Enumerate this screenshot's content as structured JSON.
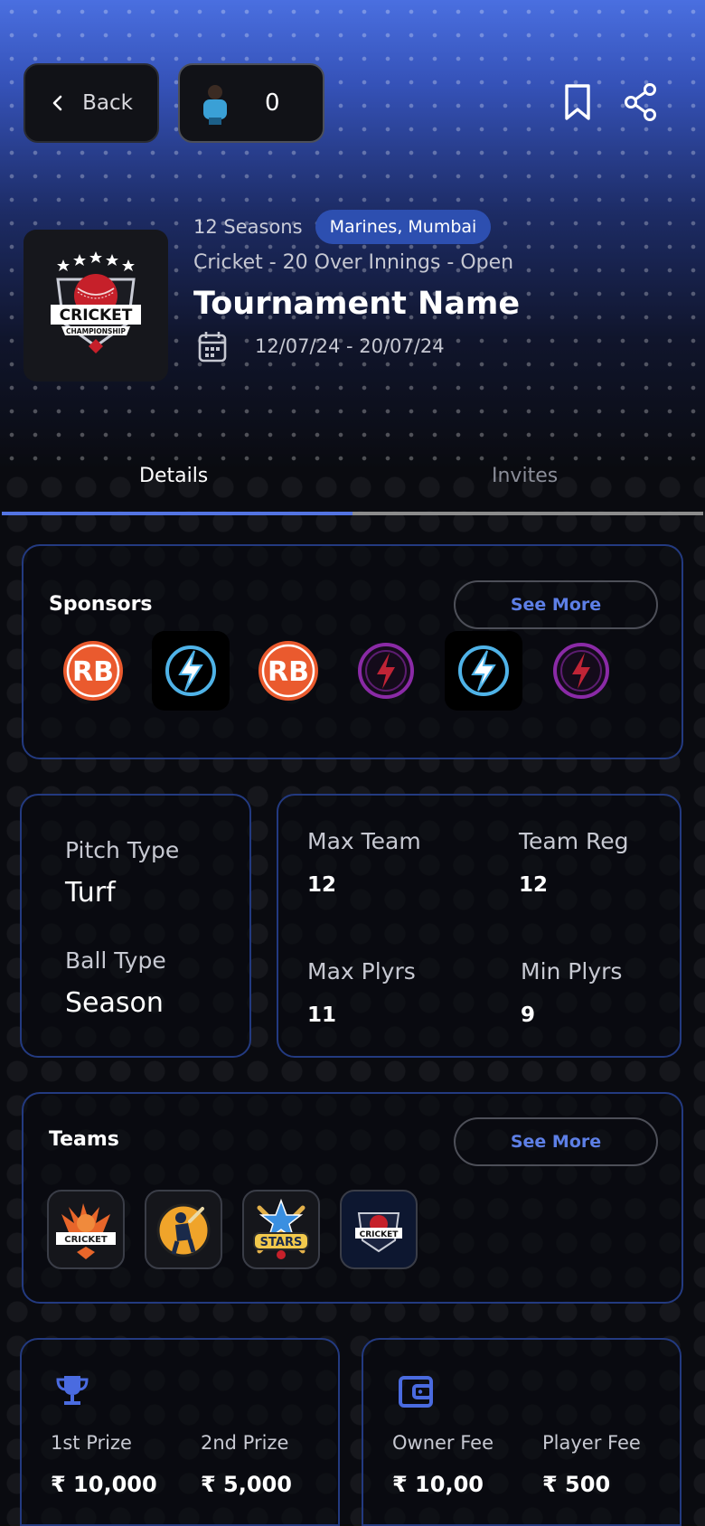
{
  "header": {
    "back_label": "Back",
    "count_value": "0"
  },
  "tournament": {
    "seasons": "12 Seasons",
    "location": "Marines, Mumbai",
    "sport_line": "Cricket - 20 Over Innings - Open",
    "name": "Tournament Name",
    "date_range": "12/07/24 - 20/07/24",
    "logo_text": "CRICKET",
    "logo_subtext": "CHAMPIONSHIP"
  },
  "tabs": [
    {
      "label": "Details",
      "active": true
    },
    {
      "label": "Invites",
      "active": false
    }
  ],
  "sponsors": {
    "title": "Sponsors",
    "see_more": "See More",
    "items": [
      "rb-logo",
      "lightning-logo",
      "rb-logo",
      "bolt-ring-logo",
      "lightning-logo",
      "bolt-ring-logo"
    ]
  },
  "pitch": {
    "pitch_type_label": "Pitch Type",
    "pitch_type_value": "Turf",
    "ball_type_label": "Ball Type",
    "ball_type_value": "Season"
  },
  "team_stats": {
    "max_team_label": "Max Team",
    "max_team_value": "12",
    "team_reg_label": "Team Reg",
    "team_reg_value": "12",
    "max_plyrs_label": "Max Plyrs",
    "max_plyrs_value": "11",
    "min_plyrs_label": "Min Plyrs",
    "min_plyrs_value": "9"
  },
  "teams": {
    "title": "Teams",
    "see_more": "See More",
    "logos": [
      {
        "icon": "cricket-tournament-logo",
        "text": "CRICKET"
      },
      {
        "icon": "batsman-logo",
        "text": ""
      },
      {
        "icon": "cricket-stars-logo",
        "text": "STARS"
      },
      {
        "icon": "cricket-shield-logo",
        "text": "CRICKET"
      }
    ]
  },
  "prizes": {
    "first_label": "1st Prize",
    "first_value": "₹ 10,000",
    "second_label": "2nd Prize",
    "second_value": "₹ 5,000"
  },
  "fees": {
    "owner_label": "Owner Fee",
    "owner_value": "₹ 10,00",
    "player_label": "Player Fee",
    "player_value": "₹ 500"
  },
  "colors": {
    "accent": "#5374e2",
    "card_border": "#233a80",
    "pill": "#2d4fb0"
  }
}
